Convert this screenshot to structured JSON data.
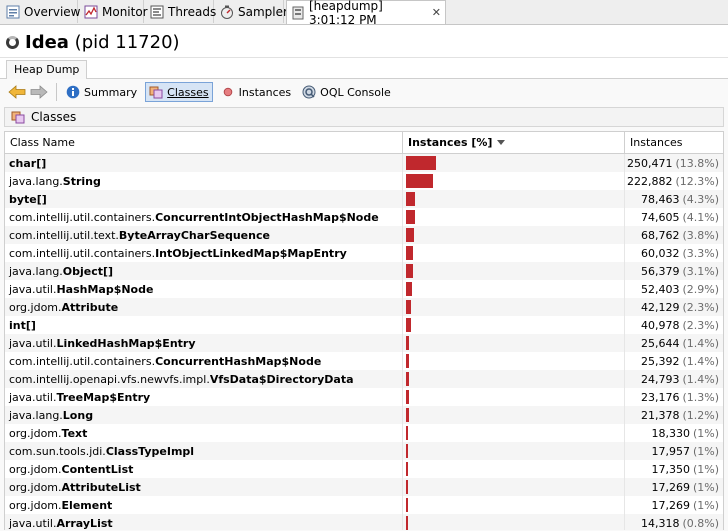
{
  "tabs": [
    {
      "label": "Overview",
      "icon": "overview-icon"
    },
    {
      "label": "Monitor",
      "icon": "monitor-icon"
    },
    {
      "label": "Threads",
      "icon": "threads-icon"
    },
    {
      "label": "Sampler",
      "icon": "sampler-icon"
    },
    {
      "label": "[heapdump] 3:01:12 PM",
      "icon": "heapdump-icon",
      "close": "✕"
    }
  ],
  "header": {
    "app_name": "Idea",
    "pid": "(pid 11720)"
  },
  "subtab": {
    "label": "Heap Dump"
  },
  "toolbar": {
    "summary": "Summary",
    "classes": "Classes",
    "instances": "Instances",
    "oql": "OQL Console"
  },
  "classes_panel": {
    "title": "Classes"
  },
  "table": {
    "columns": {
      "class_name": "Class Name",
      "instances_pct": "Instances [%]",
      "instances": "Instances"
    },
    "max_pct": 13.8,
    "rows": [
      {
        "pkg": "",
        "cls": "char[]",
        "count": "250,471",
        "pct": "(13.8%)",
        "share": 13.8
      },
      {
        "pkg": "java.lang.",
        "cls": "String",
        "count": "222,882",
        "pct": "(12.3%)",
        "share": 12.3
      },
      {
        "pkg": "",
        "cls": "byte[]",
        "count": "78,463",
        "pct": "(4.3%)",
        "share": 4.3
      },
      {
        "pkg": "com.intellij.util.containers.",
        "cls": "ConcurrentIntObjectHashMap$Node",
        "count": "74,605",
        "pct": "(4.1%)",
        "share": 4.1
      },
      {
        "pkg": "com.intellij.util.text.",
        "cls": "ByteArrayCharSequence",
        "count": "68,762",
        "pct": "(3.8%)",
        "share": 3.8
      },
      {
        "pkg": "com.intellij.util.containers.",
        "cls": "IntObjectLinkedMap$MapEntry",
        "count": "60,032",
        "pct": "(3.3%)",
        "share": 3.3
      },
      {
        "pkg": "java.lang.",
        "cls": "Object[]",
        "count": "56,379",
        "pct": "(3.1%)",
        "share": 3.1
      },
      {
        "pkg": "java.util.",
        "cls": "HashMap$Node",
        "count": "52,403",
        "pct": "(2.9%)",
        "share": 2.9
      },
      {
        "pkg": "org.jdom.",
        "cls": "Attribute",
        "count": "42,129",
        "pct": "(2.3%)",
        "share": 2.3
      },
      {
        "pkg": "",
        "cls": "int[]",
        "count": "40,978",
        "pct": "(2.3%)",
        "share": 2.3
      },
      {
        "pkg": "java.util.",
        "cls": "LinkedHashMap$Entry",
        "count": "25,644",
        "pct": "(1.4%)",
        "share": 1.4
      },
      {
        "pkg": "com.intellij.util.containers.",
        "cls": "ConcurrentHashMap$Node",
        "count": "25,392",
        "pct": "(1.4%)",
        "share": 1.4
      },
      {
        "pkg": "com.intellij.openapi.vfs.newvfs.impl.",
        "cls": "VfsData$DirectoryData",
        "count": "24,793",
        "pct": "(1.4%)",
        "share": 1.4
      },
      {
        "pkg": "java.util.",
        "cls": "TreeMap$Entry",
        "count": "23,176",
        "pct": "(1.3%)",
        "share": 1.3
      },
      {
        "pkg": "java.lang.",
        "cls": "Long",
        "count": "21,378",
        "pct": "(1.2%)",
        "share": 1.2
      },
      {
        "pkg": "org.jdom.",
        "cls": "Text",
        "count": "18,330",
        "pct": "(1%)",
        "share": 1.0
      },
      {
        "pkg": "com.sun.tools.jdi.",
        "cls": "ClassTypeImpl",
        "count": "17,957",
        "pct": "(1%)",
        "share": 1.0
      },
      {
        "pkg": "org.jdom.",
        "cls": "ContentList",
        "count": "17,350",
        "pct": "(1%)",
        "share": 1.0
      },
      {
        "pkg": "org.jdom.",
        "cls": "AttributeList",
        "count": "17,269",
        "pct": "(1%)",
        "share": 1.0
      },
      {
        "pkg": "org.jdom.",
        "cls": "Element",
        "count": "17,269",
        "pct": "(1%)",
        "share": 1.0
      },
      {
        "pkg": "java.util.",
        "cls": "ArrayList",
        "count": "14,318",
        "pct": "(0.8%)",
        "share": 0.8
      }
    ]
  },
  "colors": {
    "bar": "#c0282d",
    "accent": "#7aa3d8"
  }
}
